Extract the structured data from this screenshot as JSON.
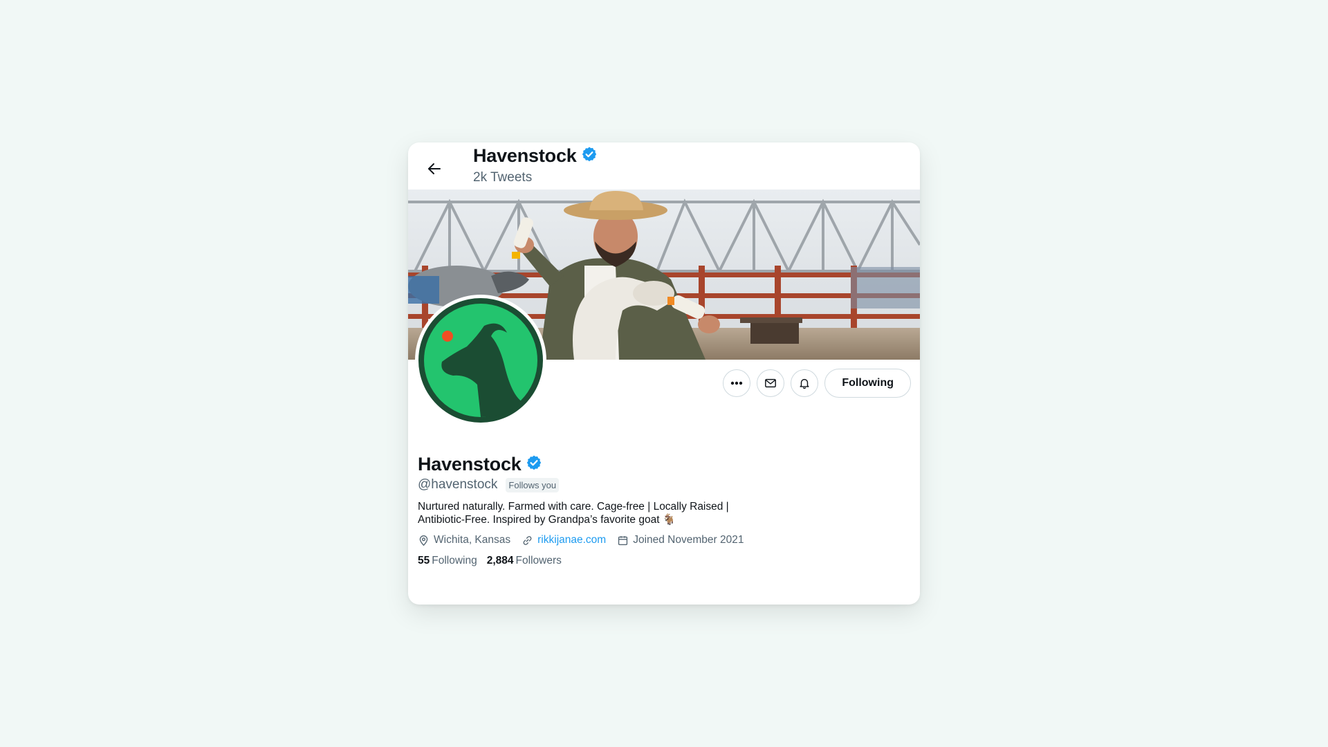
{
  "header": {
    "name": "Havenstock",
    "tweet_count": "2k Tweets"
  },
  "profile": {
    "name": "Havenstock",
    "handle": "@havenstock",
    "follows_you_badge": "Follows you",
    "bio_line1": "Nurtured naturally. Farmed with care. Cage-free | Locally Raised |",
    "bio_line2": "Antibiotic-Free. Inspired by Grandpa’s favorite goat 🐐",
    "location": "Wichita, Kansas",
    "website": "rikkijanae.com",
    "joined": "Joined November 2021",
    "following_count": "55",
    "following_label": "Following",
    "followers_count": "2,884",
    "followers_label": "Followers"
  },
  "actions": {
    "more_icon": "more-horizontal-icon",
    "message_icon": "mail-icon",
    "notify_icon": "bell-icon",
    "following_button": "Following"
  },
  "icons": {
    "back": "arrow-left-icon",
    "verified": "verified-badge-icon",
    "location": "map-pin-icon",
    "link": "link-icon",
    "calendar": "calendar-icon"
  },
  "colors": {
    "background": "#f1f8f6",
    "verified_blue": "#1d9bf0",
    "link_blue": "#1d9bf0",
    "avatar_green": "#23c46e",
    "avatar_dark_green": "#1b4d33",
    "avatar_dot": "#f04e23"
  }
}
